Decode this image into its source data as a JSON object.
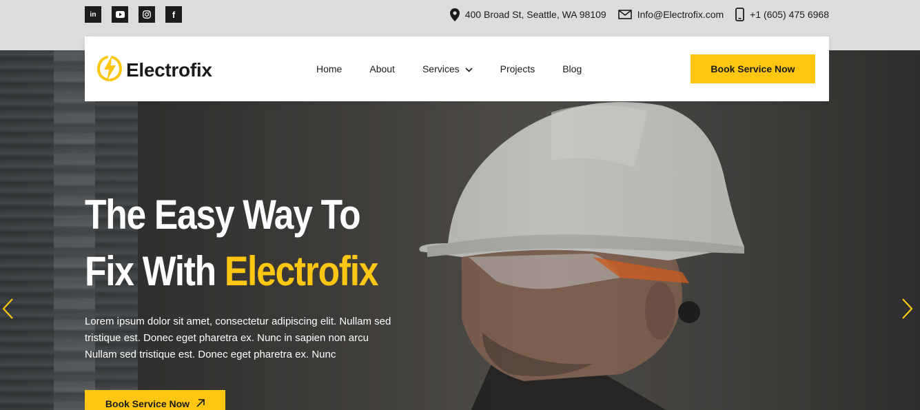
{
  "topbar": {
    "socials": [
      {
        "icon": "linkedin-icon",
        "label": "in"
      },
      {
        "icon": "youtube-icon"
      },
      {
        "icon": "instagram-icon"
      },
      {
        "icon": "facebook-icon",
        "label": "f"
      }
    ],
    "address": "400 Broad St, Seattle, WA 98109",
    "email": "Info@Electrofix.com",
    "phone": "+1 (605) 475 6968"
  },
  "nav": {
    "logo_text": "Electrofix",
    "menu": [
      "Home",
      "About",
      "Services",
      "Projects",
      "Blog"
    ],
    "book_label": "Book Service Now"
  },
  "hero": {
    "headline_line1": "The Easy Way To",
    "headline_line2_prefix": "Fix With ",
    "headline_line2_accent": "Electrofix",
    "text": "Lorem ipsum dolor sit amet, consectetur adipiscing elit. Nullam sed tristique est. Donec eget pharetra ex. Nunc in sapien non arcu Nullam sed tristique est. Donec eget pharetra ex. Nunc",
    "button_label": "Book Service Now"
  },
  "colors": {
    "accent": "#fcc612",
    "dark": "#1a1a1a",
    "topbar_bg": "#dcdcdc"
  }
}
